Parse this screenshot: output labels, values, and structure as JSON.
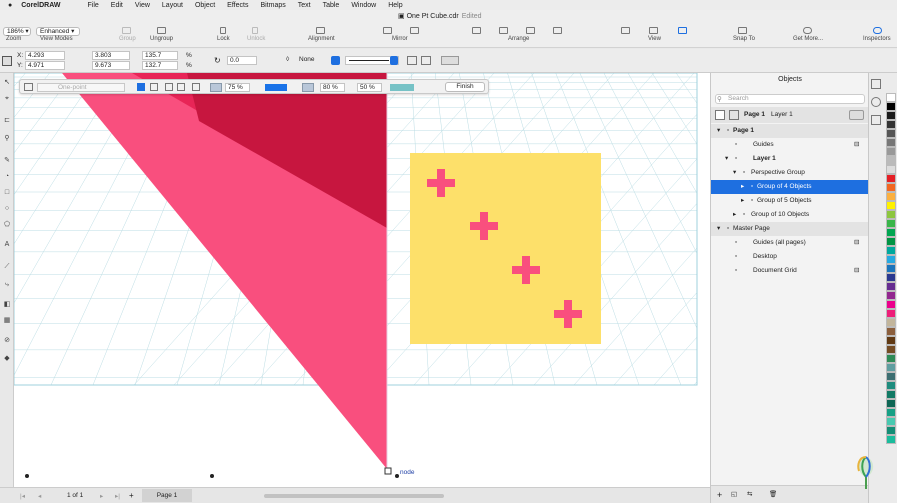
{
  "menubar": {
    "apple": "",
    "app": "CorelDRAW",
    "items": [
      "File",
      "Edit",
      "View",
      "Layout",
      "Object",
      "Effects",
      "Bitmaps",
      "Text",
      "Table",
      "Window",
      "Help"
    ]
  },
  "document": {
    "title": "One Pt Cube.cdr",
    "status": "Edited"
  },
  "toolbar": {
    "zoom_value": "186%",
    "zoom_label": "Zoom",
    "view_mode_value": "Enhanced",
    "view_mode_label": "View Modes",
    "group": "Group",
    "ungroup": "Ungroup",
    "lock": "Lock",
    "unlock": "Unlock",
    "alignment": "Alignment",
    "mirror": "Mirror",
    "arrange": "Arrange",
    "view": "View",
    "snap_to": "Snap To",
    "get_more": "Get More...",
    "inspectors": "Inspectors"
  },
  "propbar": {
    "x_label": "X:",
    "x_value": "4.293",
    "y_label": "Y:",
    "y_value": "4.971",
    "w_value": "3.803",
    "h_value": "9.673",
    "sx_value": "135.7",
    "sy_value": "132.7",
    "pct": "%",
    "rotation_value": "0.0",
    "outline_value": "None"
  },
  "perspective_toolbar": {
    "mode": "One-point",
    "opacity1": "75 %",
    "opacity2": "80 %",
    "opacity3": "50 %",
    "finish": "Finish",
    "color_blue": "#1a73e8",
    "color_teal": "#76c2c6"
  },
  "canvas": {
    "node_label": "node"
  },
  "statusbar": {
    "page_counter": "1 of 1",
    "page_tab": "Page 1"
  },
  "objects_panel": {
    "title": "Objects",
    "search_placeholder": "Search",
    "page_header": "Page 1",
    "layer_header": "Layer 1",
    "tree": [
      {
        "label": "Page 1",
        "bold": true,
        "indent": 0,
        "arrow": "▾"
      },
      {
        "label": "Guides",
        "indent": 1,
        "arrow": ""
      },
      {
        "label": "Layer 1",
        "bold": true,
        "indent": 1,
        "arrow": "▾"
      },
      {
        "label": "Perspective Group",
        "indent": 2,
        "arrow": "▾"
      },
      {
        "label": "Group of 4 Objects",
        "indent": 3,
        "arrow": "▸",
        "selected": true
      },
      {
        "label": "Group of 5 Objects",
        "indent": 3,
        "arrow": "▸"
      },
      {
        "label": "Group of 10 Objects",
        "indent": 2,
        "arrow": "▸"
      },
      {
        "label": "Master Page",
        "indent": 0,
        "arrow": "▾"
      },
      {
        "label": "Guides (all pages)",
        "indent": 1,
        "arrow": ""
      },
      {
        "label": "Desktop",
        "indent": 1,
        "arrow": ""
      },
      {
        "label": "Document Grid",
        "indent": 1,
        "arrow": ""
      }
    ]
  },
  "palette": {
    "colors": [
      "#ffffff",
      "#000000",
      "#1a1a1a",
      "#333333",
      "#555555",
      "#777777",
      "#999999",
      "#bbbbbb",
      "#dddddd",
      "#e41f26",
      "#f26722",
      "#fbb040",
      "#fff200",
      "#8dc63f",
      "#39b54a",
      "#00a651",
      "#009444",
      "#00a99d",
      "#27aae1",
      "#1c75bc",
      "#2b3990",
      "#662d91",
      "#92278f",
      "#ec008c",
      "#ed1e79",
      "#c2b59b",
      "#8b5e3c",
      "#603913",
      "#754c24",
      "#2e8b57",
      "#5f9ea0",
      "#3c6e71",
      "#1e8c7e",
      "#117a65",
      "#0e6655",
      "#16a085",
      "#48c9b0",
      "#138d75",
      "#1abc9c"
    ]
  }
}
